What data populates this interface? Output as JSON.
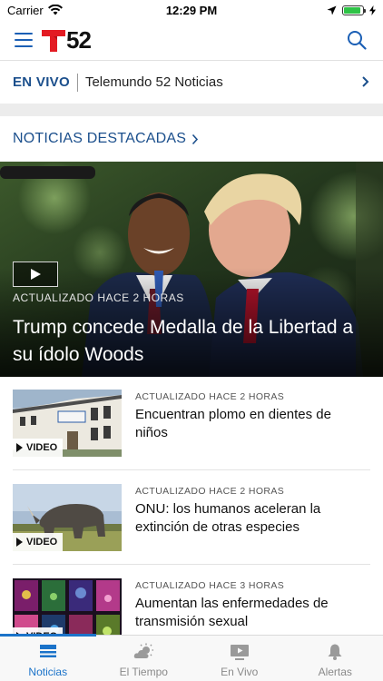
{
  "status_bar": {
    "carrier": "Carrier",
    "time": "12:29 PM",
    "battery_level": 0.9
  },
  "header": {
    "logo_number": "52",
    "logo_letter": "T",
    "menu_icon": "hamburger-menu-icon",
    "search_icon": "search-icon"
  },
  "live": {
    "tag": "EN VIVO",
    "channel": "Telemundo 52 Noticias"
  },
  "featured": {
    "section_title": "NOTICIAS DESTACADAS",
    "hero": {
      "updated": "ACTUALIZADO HACE 2 HORAS",
      "title": "Trump concede Medalla de la Libertad a su ídolo Woods"
    }
  },
  "articles": [
    {
      "updated": "ACTUALIZADO HACE 2 HORAS",
      "title": "Encuentran plomo en dientes de niños",
      "badge": "VIDEO"
    },
    {
      "updated": "ACTUALIZADO HACE 2 HORAS",
      "title": "ONU: los humanos aceleran la extinción de otras especies",
      "badge": "VIDEO"
    },
    {
      "updated": "ACTUALIZADO HACE 3 HORAS",
      "title": "Aumentan las enfermedades de transmisión sexual",
      "badge": "VIDEO"
    }
  ],
  "tabs": [
    {
      "label": "Noticias",
      "icon": "news-icon",
      "active": true
    },
    {
      "label": "El Tiempo",
      "icon": "weather-icon",
      "active": false
    },
    {
      "label": "En Vivo",
      "icon": "live-tv-icon",
      "active": false
    },
    {
      "label": "Alertas",
      "icon": "bell-icon",
      "active": false
    }
  ],
  "colors": {
    "brand_blue": "#1b4f8c",
    "accent_blue": "#1b73c9",
    "logo_red": "#e31b23",
    "battery_green": "#2fc347"
  }
}
